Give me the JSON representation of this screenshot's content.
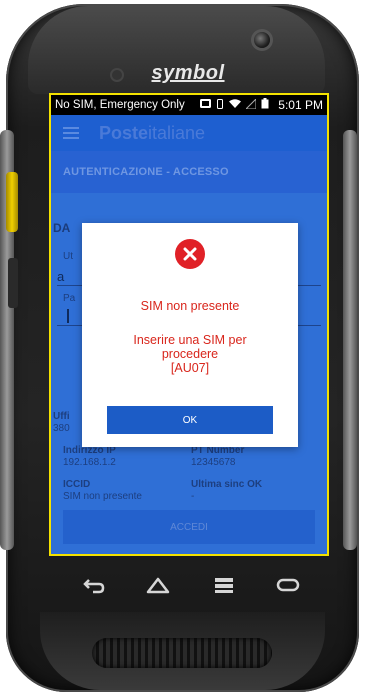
{
  "device": {
    "brand": "symbol"
  },
  "status_bar": {
    "carrier": "No SIM, Emergency Only",
    "time": "5:01 PM"
  },
  "app_bar": {
    "logo_bold": "Poste",
    "logo_regular": "italiane"
  },
  "section": {
    "title": "AUTENTICAZIONE - ACCESSO"
  },
  "background_form": {
    "section_heading": "DA",
    "field1_label": "Ut",
    "field1_value": "a",
    "field2_label": "Pa",
    "ufficio_label": "Uffi",
    "ufficio_value": "380",
    "indirizzo_ip_label": "Indirizzo IP",
    "indirizzo_ip_value": "192.168.1.2",
    "pt_number_label": "PT Number",
    "pt_number_value": "12345678",
    "iccid_label": "ICCID",
    "iccid_value": "SIM non presente",
    "ultima_sinc_label": "Ultima sinc OK",
    "ultima_sinc_value": "-",
    "accedi_label": "ACCEDI"
  },
  "dialog": {
    "title": "SIM non presente",
    "message_line1": "Inserire una SIM per",
    "message_line2": "procedere",
    "message_line3": "[AU07]",
    "ok_label": "OK"
  },
  "colors": {
    "accent": "#1c5cc6",
    "error": "#d9261c",
    "highlight_border": "#f4e200"
  },
  "icons": [
    "error-x-icon",
    "menu-icon",
    "back-icon",
    "home-icon",
    "recents-icon",
    "search-icon"
  ]
}
